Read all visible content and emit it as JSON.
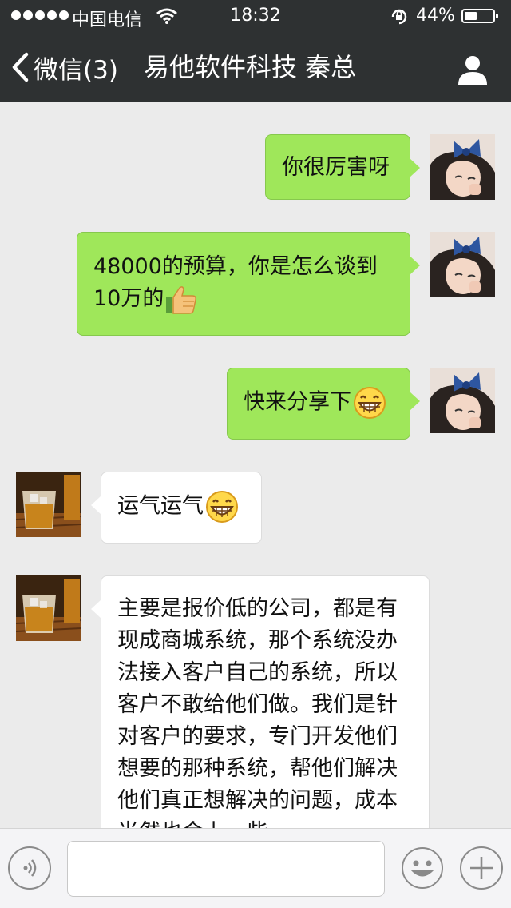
{
  "status_bar": {
    "carrier": "中国电信",
    "time": "18:32",
    "battery_percent_text": "44%",
    "battery_level": 0.44,
    "signal_dots": 5
  },
  "nav": {
    "back_label": "微信(3)",
    "title": "易他软件科技 秦总"
  },
  "messages": [
    {
      "side": "me",
      "text": "你很厉害呀",
      "emoji": null
    },
    {
      "side": "me",
      "lines": [
        "48000的预算，你是怎么谈到",
        "10万的"
      ],
      "emoji": "thumbs-up"
    },
    {
      "side": "me",
      "text": "快来分享下",
      "emoji": "grinning-face"
    },
    {
      "side": "them",
      "text": "运气运气",
      "emoji": "grinning-face"
    },
    {
      "side": "them",
      "lines": [
        "主要是报价低的公司，都是有",
        "现成商城系统，那个系统没办",
        "法接入客户自己的系统，所以",
        "客户不敢给他们做。我们是针",
        "对客户的要求，专门开发他们",
        "想要的那种系统，帮他们解决",
        "他们真正想解决的问题，成本",
        "当然也会上一些"
      ]
    }
  ],
  "input_bar": {
    "placeholder": "",
    "voice_icon": "voice-icon",
    "emoji_icon": "emoji-icon",
    "more_icon": "plus-icon"
  },
  "colors": {
    "topbar": "#2e3132",
    "chat_background": "#ebebeb",
    "outgoing_bubble": "#9fe75a",
    "incoming_bubble": "#ffffff"
  }
}
